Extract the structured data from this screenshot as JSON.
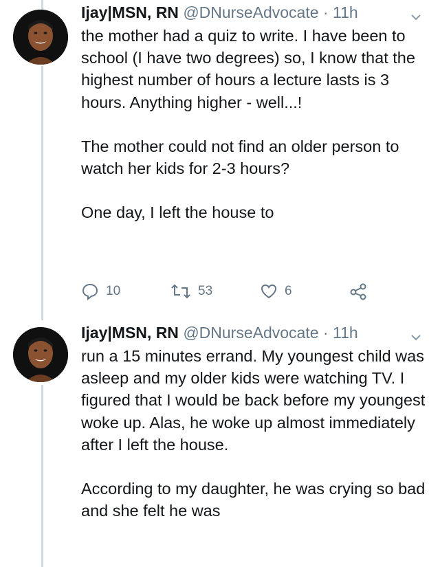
{
  "tweets": [
    {
      "author_name": "Ijay|MSN, RN",
      "handle": "@DNurseAdvocate",
      "separator": "·",
      "time": "11h",
      "paragraphs": [
        "the mother had a quiz to write. I have been to school (I have two degrees) so, I know that the highest number of hours a lecture lasts is 3 hours. Anything higher - well...!",
        "The mother could not find an older person to watch her kids for 2-3 hours?",
        "One day, I left the house to"
      ],
      "reply_count": "10",
      "retweet_count": "53",
      "like_count": "6"
    },
    {
      "author_name": "Ijay|MSN, RN",
      "handle": "@DNurseAdvocate",
      "separator": "·",
      "time": "11h",
      "paragraphs": [
        "run a 15 minutes errand. My youngest child was asleep and my older kids were watching TV. I figured that I would be back before my youngest woke up. Alas, he woke up almost immediately after I left the house.",
        "According to my daughter, he was crying so bad and she felt he was"
      ]
    }
  ],
  "icons": [
    "reply-icon",
    "retweet-icon",
    "like-icon",
    "share-icon",
    "chevron-down-icon"
  ],
  "colors": {
    "text": "#14171a",
    "secondary": "#657786",
    "thread_line": "#cfd9de"
  }
}
